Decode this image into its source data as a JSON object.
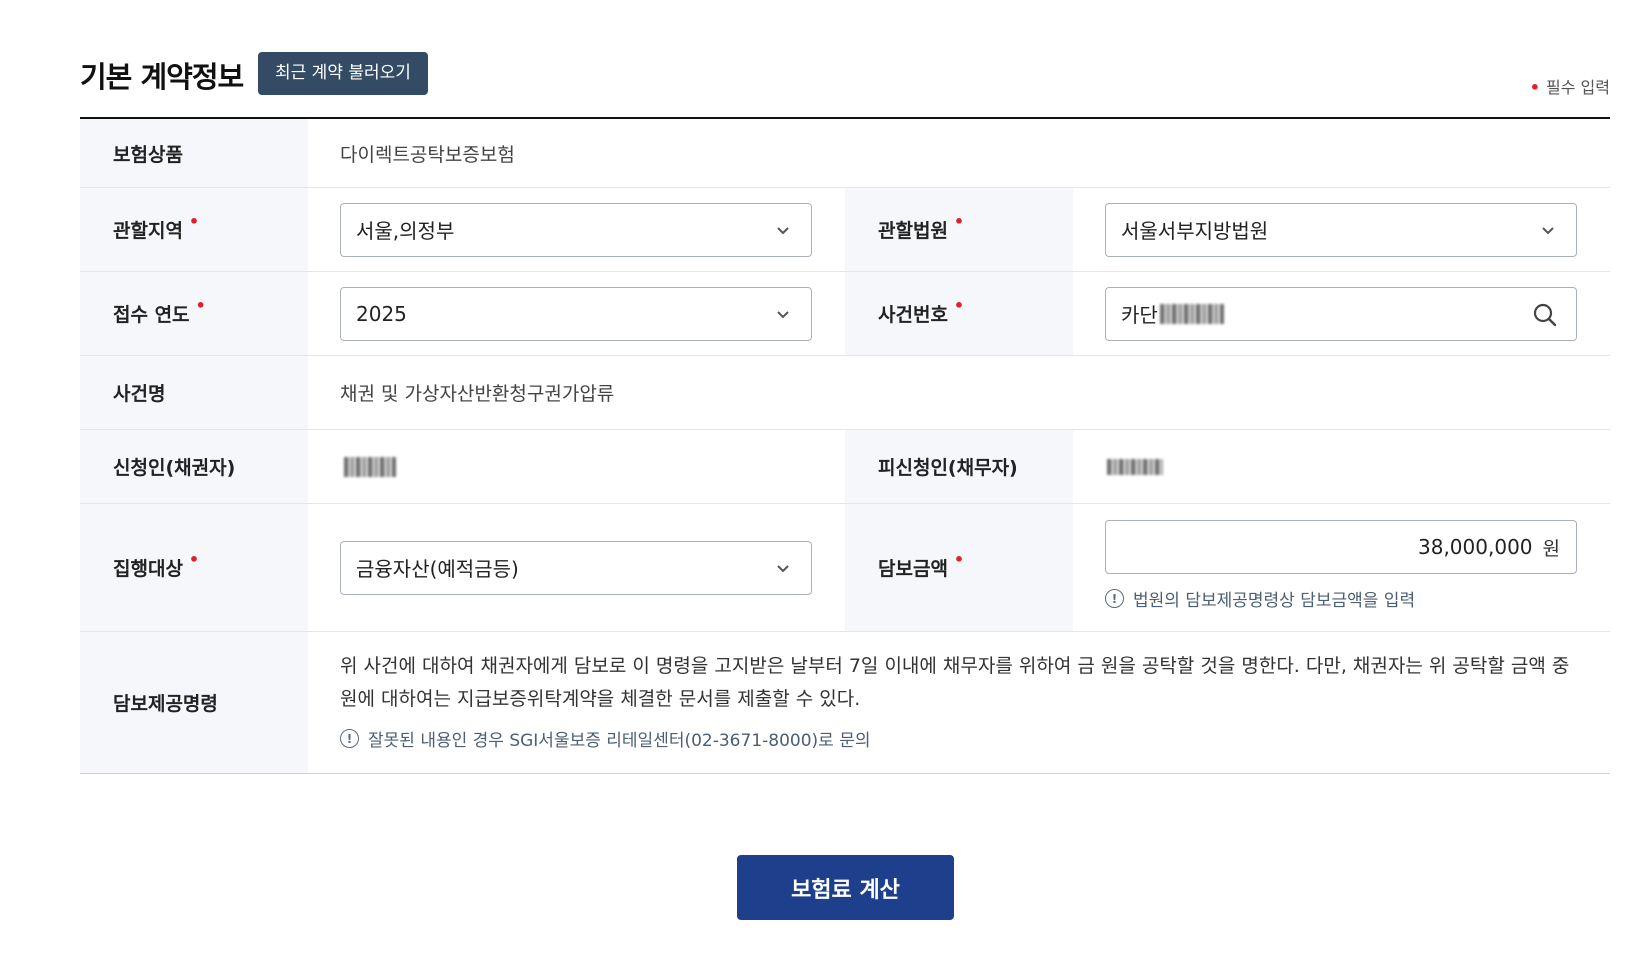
{
  "header": {
    "title": "기본 계약정보",
    "load_button": "최근 계약 불러오기",
    "required_note": "필수 입력",
    "required_mark": "•"
  },
  "form": {
    "product": {
      "label": "보험상품",
      "value": "다이렉트공탁보증보험"
    },
    "region": {
      "label": "관할지역",
      "value": "서울,의정부"
    },
    "court": {
      "label": "관할법원",
      "value": "서울서부지방법원"
    },
    "year": {
      "label": "접수 연도",
      "value": "2025"
    },
    "case_number": {
      "label": "사건번호",
      "value": "카단"
    },
    "case_name": {
      "label": "사건명",
      "value": "채권 및 가상자산반환청구권가압류"
    },
    "applicant": {
      "label": "신청인(채권자)"
    },
    "respondent": {
      "label": "피신청인(채무자)"
    },
    "target": {
      "label": "집행대상",
      "value": "금융자산(예적금등)"
    },
    "amount": {
      "label": "담보금액",
      "value": "38,000,000",
      "unit": "원",
      "hint": "법원의 담보제공명령상 담보금액을 입력"
    },
    "order": {
      "label": "담보제공명령",
      "text": "위 사건에 대하여 채권자에게 담보로 이 명령을 고지받은 날부터 7일 이내에 채무자를 위하여 금 원을 공탁할 것을 명한다. 다만, 채권자는 위 공탁할 금액 중 원에 대하여는 지급보증위탁계약을 체결한 문서를 제출할 수 있다.",
      "hint": "잘못된 내용인 경우 SGI서울보증 리테일센터(02-3671-8000)로 문의"
    },
    "required_mark": "•",
    "hint_icon": "!"
  },
  "actions": {
    "calculate": "보험료 계산"
  },
  "colors": {
    "accent": "#1d3f8c",
    "load_button": "#344b66",
    "required": "#e0202a",
    "label_bg": "#f5f7fb"
  },
  "icons": [
    "chevron-down-icon",
    "search-icon",
    "info-icon"
  ]
}
